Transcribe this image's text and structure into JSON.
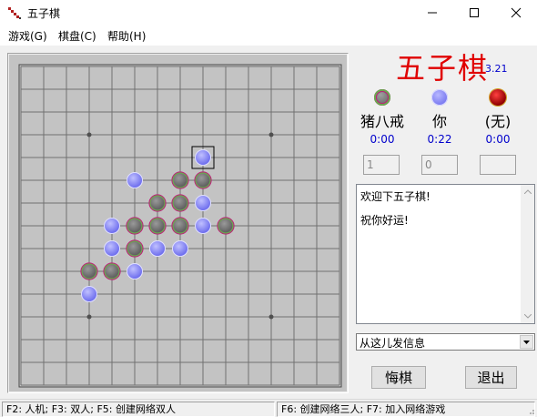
{
  "window": {
    "title": "五子棋",
    "icon": "gomoku-app-icon",
    "controls": [
      "minimize-icon",
      "maximize-icon",
      "close-icon"
    ]
  },
  "menu": {
    "items": [
      {
        "label": "游戏(G)"
      },
      {
        "label": "棋盘(C)"
      },
      {
        "label": "帮助(H)"
      }
    ]
  },
  "game": {
    "title": "五子棋",
    "version": "3.21",
    "title_color": "#e00000",
    "version_color": "#0000cc"
  },
  "players": [
    {
      "name": "猪八戒",
      "time": "0:00",
      "piece": "green-ring-gray"
    },
    {
      "name": "你",
      "time": "0:22",
      "piece": "blue"
    },
    {
      "name": "(无)",
      "time": "0:00",
      "piece": "red"
    }
  ],
  "fields": {
    "field1": "1",
    "field2": "0",
    "field3": ""
  },
  "messages": {
    "lines": [
      "欢迎下五子棋!",
      "祝你好运!"
    ]
  },
  "send": {
    "value": "从这儿发信息"
  },
  "buttons": {
    "undo": "悔棋",
    "exit": "退出"
  },
  "status": {
    "left": "F2: 人机; F3: 双人; F5: 创建网络双人",
    "right": "F6: 创建网络三人; F7: 加入网络游戏"
  },
  "board": {
    "size": 15,
    "star_points": [
      [
        3,
        3
      ],
      [
        3,
        11
      ],
      [
        11,
        3
      ],
      [
        11,
        11
      ],
      [
        7,
        7
      ]
    ],
    "last_move": [
      4,
      8
    ],
    "stones": [
      {
        "row": 4,
        "col": 8,
        "color": "blue"
      },
      {
        "row": 5,
        "col": 5,
        "color": "blue"
      },
      {
        "row": 5,
        "col": 7,
        "color": "gray"
      },
      {
        "row": 5,
        "col": 8,
        "color": "gray"
      },
      {
        "row": 6,
        "col": 6,
        "color": "gray"
      },
      {
        "row": 6,
        "col": 7,
        "color": "gray"
      },
      {
        "row": 6,
        "col": 8,
        "color": "blue"
      },
      {
        "row": 7,
        "col": 4,
        "color": "blue"
      },
      {
        "row": 7,
        "col": 5,
        "color": "gray"
      },
      {
        "row": 7,
        "col": 6,
        "color": "gray"
      },
      {
        "row": 7,
        "col": 7,
        "color": "gray"
      },
      {
        "row": 7,
        "col": 8,
        "color": "blue"
      },
      {
        "row": 7,
        "col": 9,
        "color": "gray"
      },
      {
        "row": 8,
        "col": 4,
        "color": "blue"
      },
      {
        "row": 8,
        "col": 5,
        "color": "gray"
      },
      {
        "row": 8,
        "col": 6,
        "color": "blue"
      },
      {
        "row": 8,
        "col": 7,
        "color": "blue"
      },
      {
        "row": 9,
        "col": 3,
        "color": "gray"
      },
      {
        "row": 9,
        "col": 4,
        "color": "gray"
      },
      {
        "row": 9,
        "col": 5,
        "color": "blue"
      },
      {
        "row": 10,
        "col": 3,
        "color": "blue"
      }
    ]
  }
}
